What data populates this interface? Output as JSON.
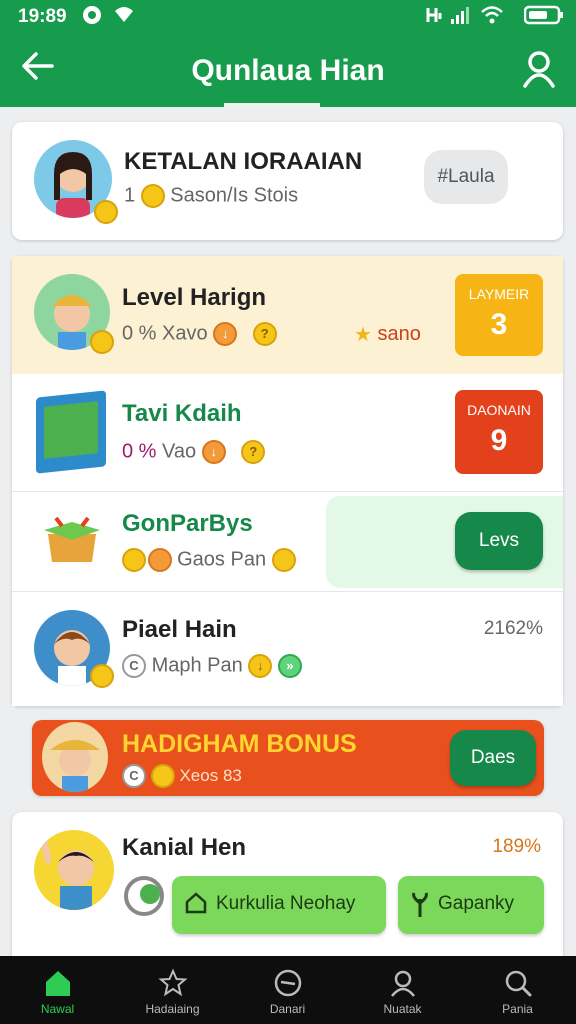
{
  "status": {
    "time": "19:89"
  },
  "header": {
    "title": "Qunlaua Hian"
  },
  "profile": {
    "name": "KETALAN IORAAIAN",
    "coins_prefix": "1",
    "subtitle": "Sason/Is Stois",
    "tag": "#Laula"
  },
  "rows": [
    {
      "title": "Level Harign",
      "sub_prefix": "0 %",
      "sub_text": "Xavo",
      "extra": "sano",
      "badge_label": "LAYMEIR",
      "badge_value": "3"
    },
    {
      "title": "Tavi Kdaih",
      "sub_prefix": "0 %",
      "sub_text": "Vao",
      "badge_label": "DAONAIN",
      "badge_value": "9"
    },
    {
      "title": "GonParBys",
      "sub_text": "Gaos Pan",
      "button": "Levs"
    },
    {
      "title": "Piael Hain",
      "sub_text": "Maph Pan",
      "right_text": "2162%"
    },
    {
      "title": "HADIGHAM BONUS",
      "sub_text": "Xeos 83",
      "button": "Daes"
    },
    {
      "title": "Kanial Hen",
      "right_text": "189%",
      "buttons": [
        "Kurkulia Neohay",
        "Gapanky"
      ]
    }
  ],
  "nav": [
    {
      "label": "Nawal"
    },
    {
      "label": "Hadaiaing"
    },
    {
      "label": "Danari"
    },
    {
      "label": "Nuatak"
    },
    {
      "label": "Pania"
    }
  ],
  "colors": {
    "header": "#169c4c",
    "badge_yellow": "#f7b515",
    "badge_red": "#e3401c",
    "bonus_orange": "#e8501e",
    "green_button": "#16884a",
    "lime_button": "#7bd85b"
  }
}
